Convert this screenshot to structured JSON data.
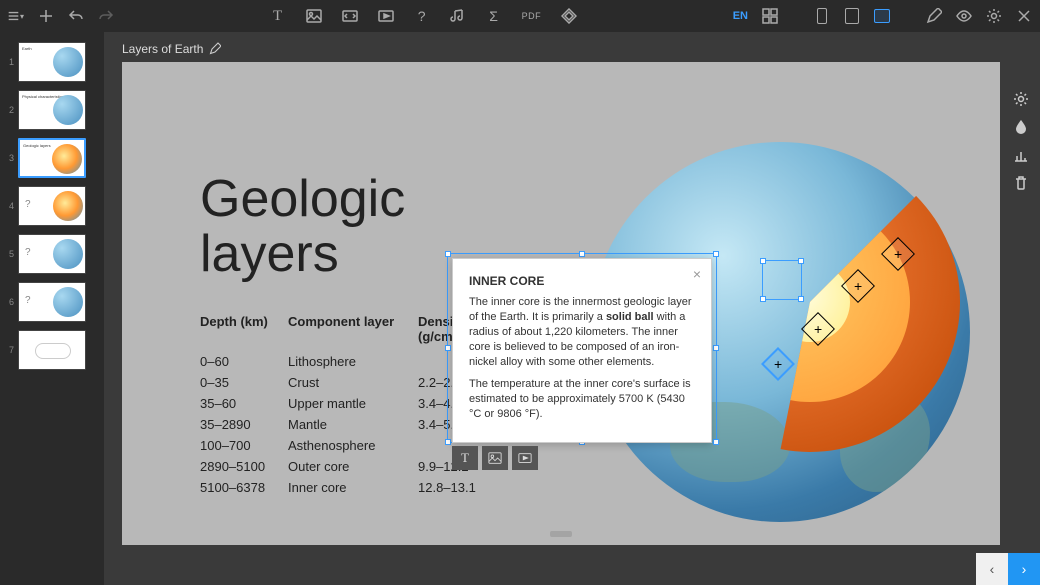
{
  "doc_title": "Layers of Earth",
  "lang": "EN",
  "pdf": "PDF",
  "slides": [
    {
      "num": "1",
      "title": "Earth",
      "type": "globe"
    },
    {
      "num": "2",
      "title": "Physical characteristics",
      "type": "globe"
    },
    {
      "num": "3",
      "title": "Geologic layers",
      "type": "cut",
      "active": true
    },
    {
      "num": "4",
      "title": "?",
      "type": "cut-q"
    },
    {
      "num": "5",
      "title": "?",
      "type": "globe-q"
    },
    {
      "num": "6",
      "title": "?",
      "type": "globe-q"
    },
    {
      "num": "7",
      "title": "",
      "type": "chart"
    }
  ],
  "slide": {
    "title_l1": "Geologic",
    "title_l2": "layers",
    "table": {
      "head": {
        "c1": "Depth (km)",
        "c2": "Component layer",
        "c3": "Density (g/cm³)"
      },
      "rows": [
        {
          "c1": "0–60",
          "c2": "Lithosphere",
          "c3": ""
        },
        {
          "c1": "0–35",
          "c2": "Crust",
          "c3": "2.2–2.9"
        },
        {
          "c1": "35–60",
          "c2": "Upper mantle",
          "c3": "3.4–4.4"
        },
        {
          "c1": "35–2890",
          "c2": "Mantle",
          "c3": "3.4–5.6"
        },
        {
          "c1": "100–700",
          "c2": "Asthenosphere",
          "c3": ""
        },
        {
          "c1": "2890–5100",
          "c2": "Outer core",
          "c3": "9.9–12.2"
        },
        {
          "c1": "5100–6378",
          "c2": "Inner core",
          "c3": "12.8–13.1"
        }
      ]
    }
  },
  "popup": {
    "title": "INNER CORE",
    "p1a": "The inner core is the innermost geologic layer of the Earth. It is primarily a ",
    "p1b": "solid ball",
    "p1c": " with a radius of about 1,220 kilometers. The inner core is believed to be composed of an iron-nickel alloy with some other elements.",
    "p2": "The temperature at the inner core's surface is estimated to be approximately 5700 K (5430 °C or 9806 °F)."
  }
}
